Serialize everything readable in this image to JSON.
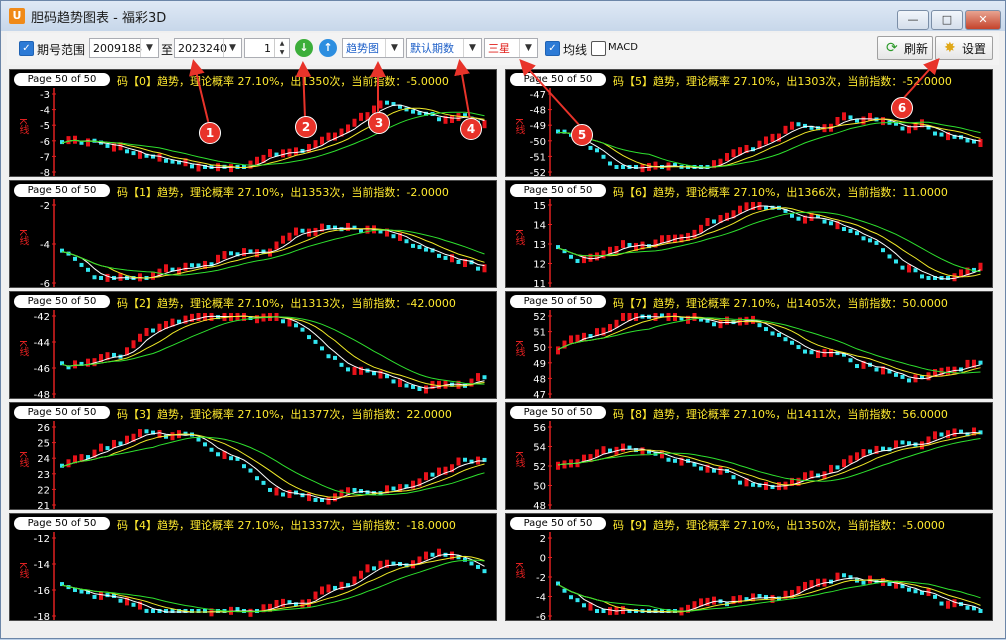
{
  "window": {
    "title": "胆码趋势图表 - 福彩3D",
    "app_icon": "app-logo-icon",
    "min_label": "—",
    "max_label": "□",
    "close_label": "✕"
  },
  "toolbar": {
    "period_range_label": "期号范围",
    "period_range_checked": true,
    "start_period": "2009188",
    "to_label": "至",
    "end_period": "2023240",
    "step_value": "1",
    "chart_type": "趋势图",
    "period_mode": "默认期数",
    "position": "三星",
    "ma_label": "均线",
    "ma_checked": true,
    "macd_label": "MACD",
    "macd_checked": false,
    "refresh_label": "刷新",
    "settings_label": "设置",
    "refresh_icon": "refresh-icon",
    "settings_icon": "gear-icon",
    "down_icon": "arrow-down-icon",
    "up_icon": "arrow-up-icon"
  },
  "annotations": [
    "1",
    "2",
    "3",
    "4",
    "5",
    "6"
  ],
  "panels": [
    {
      "tab": "Page 50 of 50",
      "title": "码【0】趋势，理论概率 27.10%，出1350次，当前指数：-5.0000",
      "ylabel": "K线",
      "ticks": [
        "-3",
        "-4",
        "-5",
        "-6",
        "-7",
        "-8"
      ]
    },
    {
      "tab": "Page 50 of 50",
      "title": "码【5】趋势，理论概率 27.10%，出1303次，当前指数：-52.0000",
      "ylabel": "K线",
      "ticks": [
        "-47",
        "-48",
        "-49",
        "-50",
        "-51",
        "-52"
      ]
    },
    {
      "tab": "Page 50 of 50",
      "title": "码【1】趋势，理论概率 27.10%，出1353次，当前指数：-2.0000",
      "ylabel": "K线",
      "ticks": [
        "-2",
        "-4",
        "-6"
      ]
    },
    {
      "tab": "Page 50 of 50",
      "title": "码【6】趋势，理论概率 27.10%，出1366次，当前指数：11.0000",
      "ylabel": "K线",
      "ticks": [
        "15",
        "14",
        "13",
        "12",
        "11"
      ]
    },
    {
      "tab": "Page 50 of 50",
      "title": "码【2】趋势，理论概率 27.10%，出1313次，当前指数：-42.0000",
      "ylabel": "K线",
      "ticks": [
        "-42",
        "-44",
        "-46",
        "-48"
      ]
    },
    {
      "tab": "Page 50 of 50",
      "title": "码【7】趋势，理论概率 27.10%，出1405次，当前指数：50.0000",
      "ylabel": "K线",
      "ticks": [
        "52",
        "51",
        "50",
        "49",
        "48",
        "47"
      ]
    },
    {
      "tab": "Page 50 of 50",
      "title": "码【3】趋势，理论概率 27.10%，出1377次，当前指数：22.0000",
      "ylabel": "K线",
      "ticks": [
        "26",
        "25",
        "24",
        "23",
        "22",
        "21"
      ]
    },
    {
      "tab": "Page 50 of 50",
      "title": "码【8】趋势，理论概率 27.10%，出1411次，当前指数：56.0000",
      "ylabel": "K线",
      "ticks": [
        "56",
        "54",
        "52",
        "50",
        "48"
      ]
    },
    {
      "tab": "Page 50 of 50",
      "title": "码【4】趋势，理论概率 27.10%，出1337次，当前指数：-18.0000",
      "ylabel": "K线",
      "ticks": [
        "-12",
        "-14",
        "-16",
        "-18"
      ]
    },
    {
      "tab": "Page 50 of 50",
      "title": "码【9】趋势，理论概率 27.10%，出1350次，当前指数：-5.0000",
      "ylabel": "K线",
      "ticks": [
        "2",
        "0",
        "-2",
        "-4",
        "-6"
      ]
    }
  ],
  "colors": {
    "up": "#e8121a",
    "down": "#32e6f0",
    "ma1": "#ffffff",
    "ma2": "#f0ea28",
    "ma3": "#2ee02e",
    "annotation": "#e8332a",
    "tick": "#e02020"
  }
}
